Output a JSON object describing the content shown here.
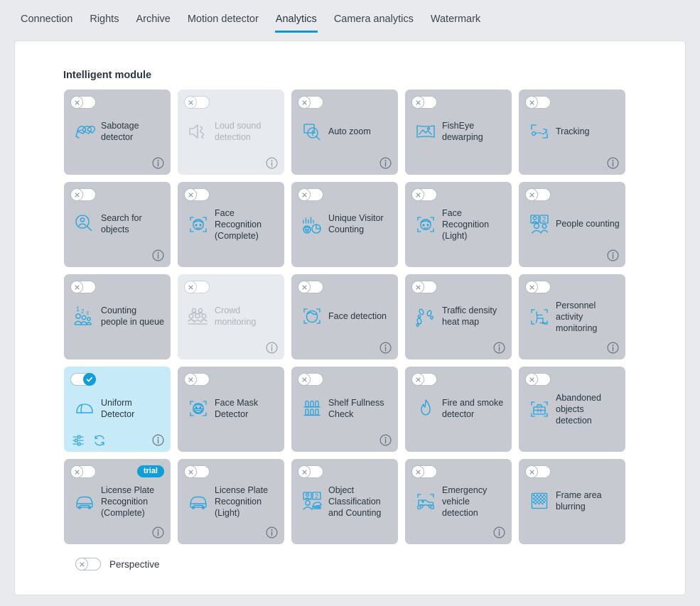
{
  "tabs": [
    {
      "label": "Connection",
      "active": false
    },
    {
      "label": "Rights",
      "active": false
    },
    {
      "label": "Archive",
      "active": false
    },
    {
      "label": "Motion detector",
      "active": false
    },
    {
      "label": "Analytics",
      "active": true
    },
    {
      "label": "Camera analytics",
      "active": false
    },
    {
      "label": "Watermark",
      "active": false
    }
  ],
  "panel": {
    "title": "Intelligent module"
  },
  "colors": {
    "accent": "#0e9fd8",
    "icon_blue": "#26a3de",
    "card_bg": "#c6c9cf",
    "card_bg_disabled": "#e7eaee",
    "card_bg_active": "#c6eaf8",
    "page_bg": "#e8eaed",
    "panel_bg": "#ffffff",
    "text": "#2b3642",
    "text_disabled": "#aeb4bc"
  },
  "modules": [
    [
      {
        "label": "Sabotage detector",
        "icon": "sabotage-detector-icon",
        "state": "off",
        "disabled": false,
        "info": true,
        "badge": null
      },
      {
        "label": "Loud sound detection",
        "icon": "loud-sound-detection-icon",
        "state": "off",
        "disabled": true,
        "info": true,
        "badge": null
      },
      {
        "label": "Auto zoom",
        "icon": "auto-zoom-icon",
        "state": "off",
        "disabled": false,
        "info": true,
        "badge": null
      },
      {
        "label": "FishEye dewarping",
        "icon": "fisheye-dewarping-icon",
        "state": "off",
        "disabled": false,
        "info": false,
        "badge": null
      },
      {
        "label": "Tracking",
        "icon": "tracking-icon",
        "state": "off",
        "disabled": false,
        "info": true,
        "badge": null
      }
    ],
    [
      {
        "label": "Search for objects",
        "icon": "search-for-objects-icon",
        "state": "off",
        "disabled": false,
        "info": true,
        "badge": null
      },
      {
        "label": "Face Recognition (Complete)",
        "icon": "face-recognition-complete-icon",
        "state": "off",
        "disabled": false,
        "info": false,
        "badge": null
      },
      {
        "label": "Unique Visitor Counting",
        "icon": "unique-visitor-counting-icon",
        "state": "off",
        "disabled": false,
        "info": false,
        "badge": null
      },
      {
        "label": "Face Recognition (Light)",
        "icon": "face-recognition-light-icon",
        "state": "off",
        "disabled": false,
        "info": false,
        "badge": null
      },
      {
        "label": "People counting",
        "icon": "people-counting-icon",
        "state": "off",
        "disabled": false,
        "info": true,
        "badge": null
      }
    ],
    [
      {
        "label": "Counting people in queue",
        "icon": "counting-people-in-queue-icon",
        "state": "off",
        "disabled": false,
        "info": false,
        "badge": null
      },
      {
        "label": "Crowd monitoring",
        "icon": "crowd-monitoring-icon",
        "state": "off",
        "disabled": true,
        "info": true,
        "badge": null
      },
      {
        "label": "Face detection",
        "icon": "face-detection-icon",
        "state": "off",
        "disabled": false,
        "info": true,
        "badge": null
      },
      {
        "label": "Traffic density heat map",
        "icon": "traffic-density-heat-map-icon",
        "state": "off",
        "disabled": false,
        "info": true,
        "badge": null
      },
      {
        "label": "Personnel activity monitoring",
        "icon": "personnel-activity-monitoring-icon",
        "state": "off",
        "disabled": false,
        "info": true,
        "badge": null
      }
    ],
    [
      {
        "label": "Uniform Detector",
        "icon": "uniform-detector-icon",
        "state": "on",
        "disabled": false,
        "info": true,
        "badge": null,
        "actions": [
          "settings-sliders-icon",
          "refresh-icon"
        ]
      },
      {
        "label": "Face Mask Detector",
        "icon": "face-mask-detector-icon",
        "state": "off",
        "disabled": false,
        "info": false,
        "badge": null
      },
      {
        "label": "Shelf Fullness Check",
        "icon": "shelf-fullness-check-icon",
        "state": "off",
        "disabled": false,
        "info": true,
        "badge": null
      },
      {
        "label": "Fire and smoke detector",
        "icon": "fire-and-smoke-detector-icon",
        "state": "off",
        "disabled": false,
        "info": false,
        "badge": null
      },
      {
        "label": "Abandoned objects detection",
        "icon": "abandoned-objects-detection-icon",
        "state": "off",
        "disabled": false,
        "info": false,
        "badge": null
      }
    ],
    [
      {
        "label": "License Plate Recognition (Complete)",
        "icon": "license-plate-recognition-complete-icon",
        "state": "off",
        "disabled": false,
        "info": true,
        "badge": "trial"
      },
      {
        "label": "License Plate Recognition (Light)",
        "icon": "license-plate-recognition-light-icon",
        "state": "off",
        "disabled": false,
        "info": true,
        "badge": null
      },
      {
        "label": "Object Classification and Counting",
        "icon": "object-classification-and-counting-icon",
        "state": "off",
        "disabled": false,
        "info": false,
        "badge": null
      },
      {
        "label": "Emergency vehicle detection",
        "icon": "emergency-vehicle-detection-icon",
        "state": "off",
        "disabled": false,
        "info": true,
        "badge": null
      },
      {
        "label": "Frame area blurring",
        "icon": "frame-area-blurring-icon",
        "state": "off",
        "disabled": false,
        "info": false,
        "badge": null
      }
    ]
  ],
  "perspective": {
    "label": "Perspective",
    "state": "off"
  }
}
